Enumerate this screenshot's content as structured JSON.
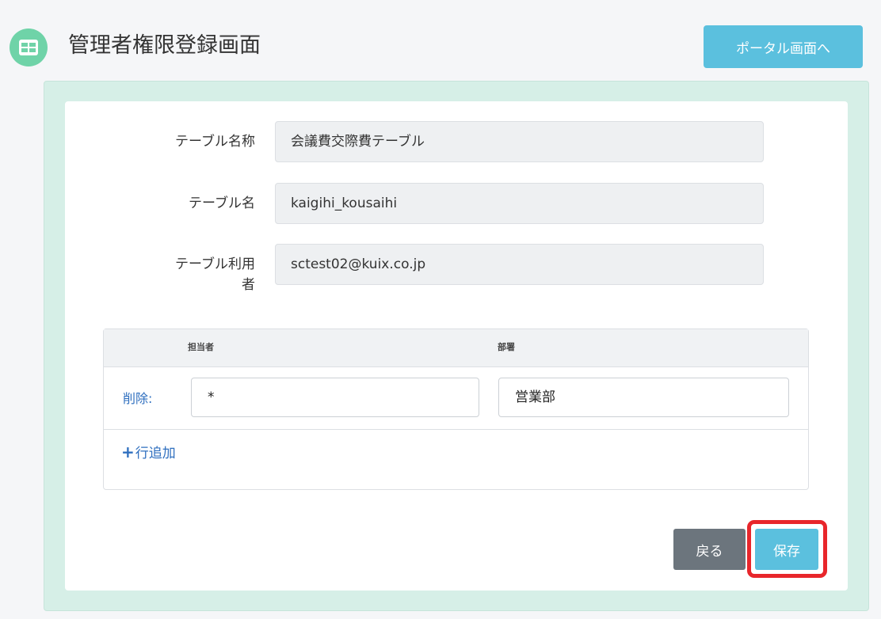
{
  "header": {
    "icon": "table-icon",
    "title": "管理者権限登録画面",
    "portal_button_label": "ポータル画面へ"
  },
  "form": {
    "table_display_name": {
      "label": "テーブル名称",
      "value": "会議費交際費テーブル"
    },
    "table_name": {
      "label": "テーブル名",
      "value": "kaigihi_kousaihi"
    },
    "table_user": {
      "label_line1": "テーブル利用",
      "label_line2": "者",
      "value": "sctest02@kuix.co.jp"
    }
  },
  "assignment_table": {
    "columns": [
      "担当者",
      "部署"
    ],
    "rows": [
      {
        "delete_label": "削除:",
        "person": "*",
        "department": "営業部"
      }
    ],
    "add_row_plus": "+",
    "add_row_label": "行追加"
  },
  "actions": {
    "back_label": "戻る",
    "save_label": "保存",
    "highlight_color": "#e8262b"
  },
  "colors": {
    "accent": "#5bc0de",
    "panel": "#d6efe7",
    "icon_badge": "#6fd3a8",
    "link": "#2f6fbf"
  }
}
